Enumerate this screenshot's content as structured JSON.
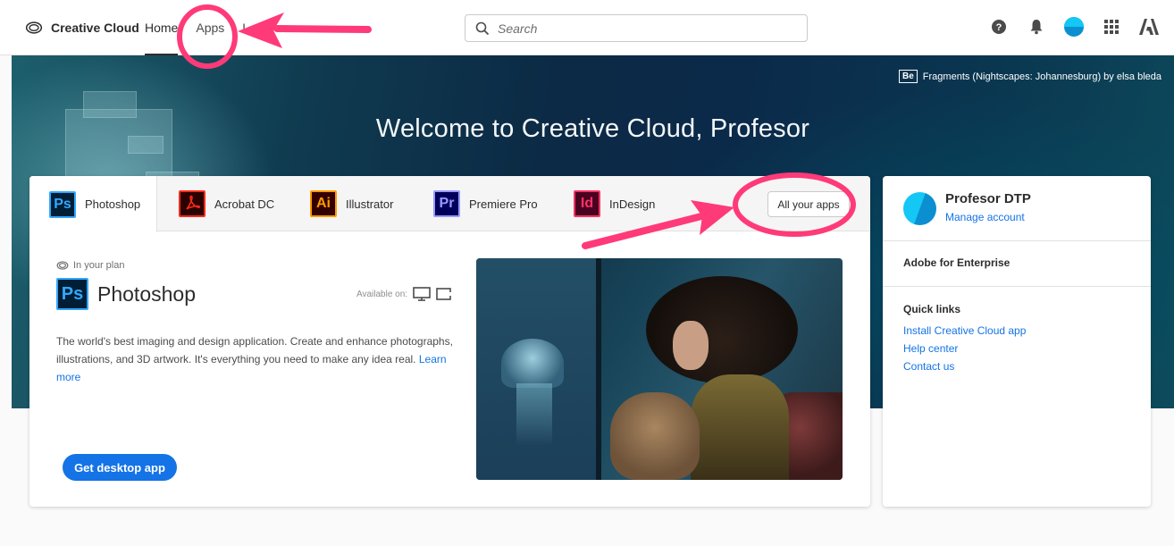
{
  "topbar": {
    "brand": "Creative Cloud",
    "nav": [
      "Home",
      "Apps",
      "Learn"
    ],
    "search_placeholder": "Search"
  },
  "hero": {
    "attribution_badge": "Be",
    "attribution": "Fragments (Nightscapes: Johannesburg) by elsa bleda",
    "title": "Welcome to Creative Cloud, Profesor"
  },
  "tabs": [
    {
      "label": "Photoshop",
      "code": "Ps",
      "bg": "#001e36",
      "fg": "#31a8ff"
    },
    {
      "label": "Acrobat DC",
      "code": "acrobat",
      "bg": "#2b0000",
      "fg": "#ff2a1a"
    },
    {
      "label": "Illustrator",
      "code": "Ai",
      "bg": "#330000",
      "fg": "#ff9a00"
    },
    {
      "label": "Premiere Pro",
      "code": "Pr",
      "bg": "#00005b",
      "fg": "#9999ff"
    },
    {
      "label": "InDesign",
      "code": "Id",
      "bg": "#49021f",
      "fg": "#ff3366"
    }
  ],
  "all_apps_label": "All your apps",
  "detail": {
    "plan": "In your plan",
    "badge": "Ps",
    "title": "Photoshop",
    "available": "Available on:",
    "description": "The world's best imaging and design application. Create and enhance photographs, illustrations, and 3D artwork. It's everything you need to make any idea real.",
    "learn_more": "Learn more",
    "cta": "Get desktop app"
  },
  "side": {
    "user_name": "Profesor DTP",
    "manage": "Manage account",
    "enterprise": "Adobe for Enterprise",
    "quick_links_title": "Quick links",
    "quick_links": [
      "Install Creative Cloud app",
      "Help center",
      "Contact us"
    ]
  },
  "colors": {
    "accent": "#1473e6",
    "annotation": "#ff3a78"
  }
}
